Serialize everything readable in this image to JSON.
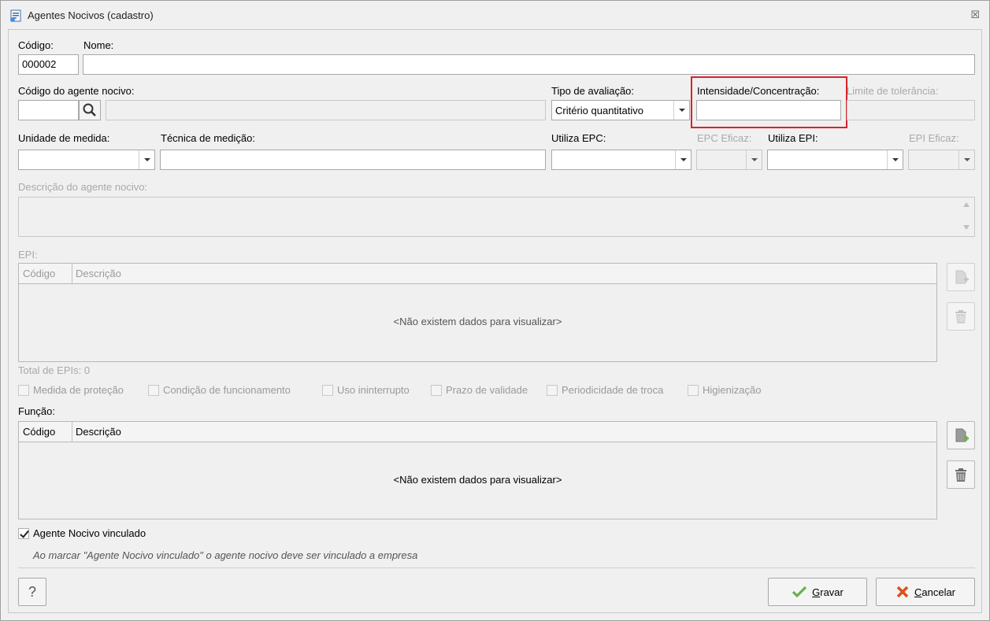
{
  "window": {
    "title": "Agentes Nocivos (cadastro)",
    "close_glyph": "☒"
  },
  "form": {
    "codigo_label": "Código:",
    "codigo_value": "000002",
    "nome_label": "Nome:",
    "nome_value": "",
    "codigo_agente_label": "Código do agente nocivo:",
    "tipo_avaliacao_label": "Tipo de avaliação:",
    "tipo_avaliacao_value": "Critério quantitativo",
    "intensidade_label": "Intensidade/Concentração:",
    "limite_label": "Limite de tolerância:",
    "unidade_label": "Unidade de medida:",
    "tecnica_label": "Técnica de medição:",
    "utiliza_epc_label": "Utiliza EPC:",
    "epc_eficaz_label": "EPC Eficaz:",
    "utiliza_epi_label": "Utiliza EPI:",
    "epi_eficaz_label": "EPI Eficaz:",
    "descricao_label": "Descrição do agente nocivo:"
  },
  "epi": {
    "label": "EPI:",
    "columns": [
      "Código",
      "Descrição"
    ],
    "empty_text": "<Não existem dados para visualizar>",
    "total": "Total de EPIs: 0",
    "checks": [
      "Medida de proteção",
      "Condição de funcionamento",
      "Uso ininterrupto",
      "Prazo de validade",
      "Periodicidade de troca",
      "Higienização"
    ]
  },
  "funcao": {
    "label": "Função:",
    "columns": [
      "Código",
      "Descrição"
    ],
    "empty_text": "<Não existem dados para visualizar>"
  },
  "vinculado": {
    "label": "Agente Nocivo vinculado",
    "checked": true,
    "note": "Ao marcar \"Agente Nocivo vinculado\" o agente nocivo deve ser vinculado a empresa"
  },
  "buttons": {
    "help": "?",
    "save_first": "G",
    "save_rest": "ravar",
    "cancel_first": "C",
    "cancel_rest": "ancelar"
  },
  "colors": {
    "highlight": "#d9232a",
    "save_check": "#6ab04c",
    "cancel_x": "#d9531e"
  }
}
